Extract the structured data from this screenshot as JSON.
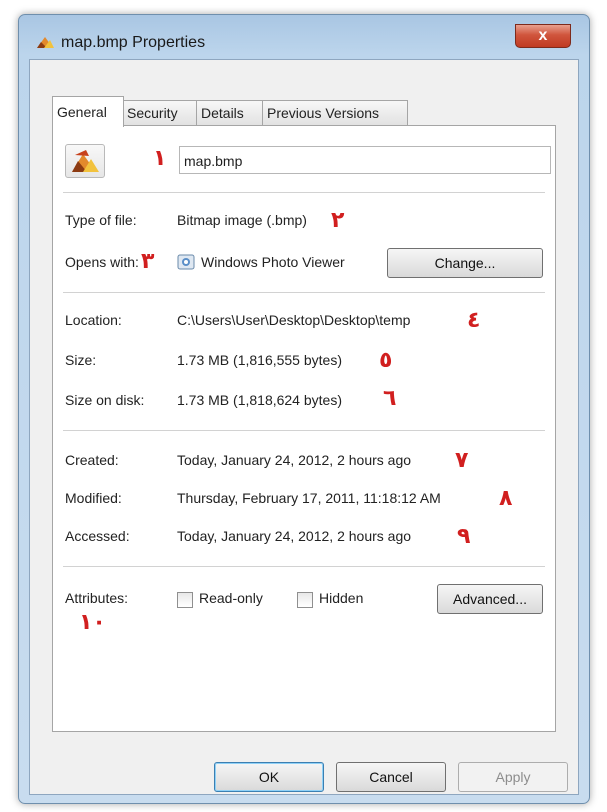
{
  "window": {
    "title": "map.bmp Properties",
    "close_glyph": "x"
  },
  "tabs": [
    {
      "label": "General"
    },
    {
      "label": "Security"
    },
    {
      "label": "Details"
    },
    {
      "label": "Previous Versions"
    }
  ],
  "general": {
    "file_name": "map.bmp",
    "type_label": "Type of file:",
    "type_value": "Bitmap image (.bmp)",
    "opens_label": "Opens with:",
    "opens_value": "Windows Photo Viewer",
    "change_button": "Change...",
    "location_label": "Location:",
    "location_value": "C:\\Users\\User\\Desktop\\Desktop\\temp",
    "size_label": "Size:",
    "size_value": "1.73 MB (1,816,555 bytes)",
    "size_disk_label": "Size on disk:",
    "size_disk_value": "1.73 MB (1,818,624 bytes)",
    "created_label": "Created:",
    "created_value": "Today, January 24, 2012, 2 hours ago",
    "modified_label": "Modified:",
    "modified_value": "Thursday, February 17, 2011, 11:18:12 AM",
    "accessed_label": "Accessed:",
    "accessed_value": "Today, January 24, 2012, 2 hours ago",
    "attributes_label": "Attributes:",
    "readonly_label": "Read-only",
    "hidden_label": "Hidden",
    "advanced_button": "Advanced..."
  },
  "buttons": {
    "ok": "OK",
    "cancel": "Cancel",
    "apply": "Apply"
  },
  "annotations": [
    "١",
    "٢",
    "٣",
    "٤",
    "٥",
    "٦",
    "٧",
    "٨",
    "٩",
    "١٠"
  ],
  "icons": {
    "title_icon": "bitmap-file-icon",
    "file_icon": "bitmap-file-icon",
    "viewer_icon": "photo-viewer-icon"
  },
  "colors": {
    "frame": "#bcd5ec",
    "close": "#c8452c",
    "annotation": "#d11f1f"
  }
}
